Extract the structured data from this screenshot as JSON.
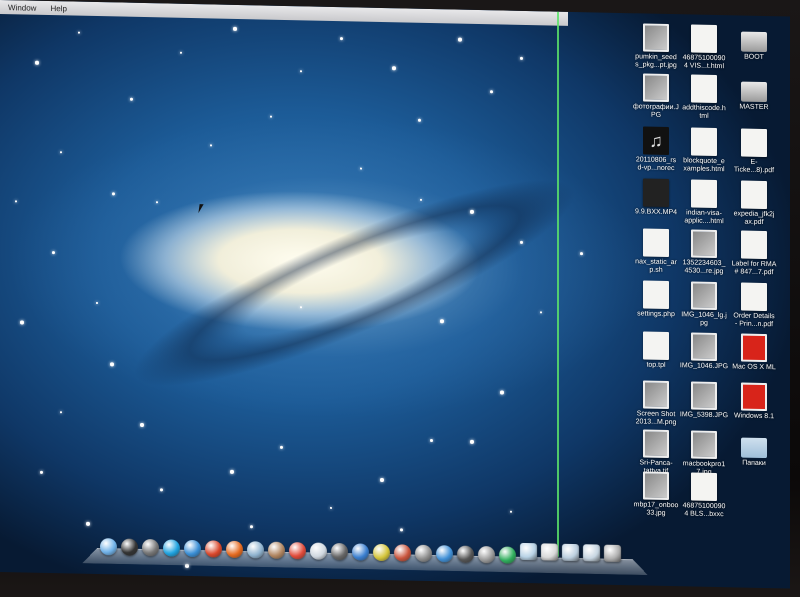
{
  "menu_bar": {
    "items": [
      "Window",
      "Help"
    ]
  },
  "desktop_files": [
    {
      "name": "pumkin_seed\ns_pkg...pt.jpg",
      "icon": "image-icon"
    },
    {
      "name": "46875100090\n4 VIS...t.html",
      "icon": "html-document-icon"
    },
    {
      "name": "BOOT",
      "icon": "drive-icon"
    },
    {
      "name": "фотографии.J\nPG",
      "icon": "image-icon"
    },
    {
      "name": "addthiscode.h\ntml",
      "icon": "html-document-icon"
    },
    {
      "name": "MASTER",
      "icon": "drive-icon"
    },
    {
      "name": "20110806_rs\nd-vp...norec",
      "icon": "music-icon"
    },
    {
      "name": "blockquote_e\nxamples.html",
      "icon": "html-document-icon"
    },
    {
      "name": "E-\nTicke...8).pdf",
      "icon": "pdf-document-icon"
    },
    {
      "name": "9.9.BXX.MP4",
      "icon": "video-icon"
    },
    {
      "name": "indian-visa-\napplic....html",
      "icon": "html-document-icon"
    },
    {
      "name": "expedia_jfk2j\nax.pdf",
      "icon": "pdf-document-icon"
    },
    {
      "name": "nax_static_ar\np.sh",
      "icon": "shell-document-icon"
    },
    {
      "name": "1352234603_\n4530...re.jpg",
      "icon": "image-icon"
    },
    {
      "name": "Label for RMA\n# 847...7.pdf",
      "icon": "pdf-document-icon"
    },
    {
      "name": "settings.php",
      "icon": "php-document-icon"
    },
    {
      "name": "IMG_1046_lg.j\npg",
      "icon": "image-icon"
    },
    {
      "name": "Order Details\n- Prin...n.pdf",
      "icon": "pdf-document-icon"
    },
    {
      "name": "top.tpl",
      "icon": "document-icon"
    },
    {
      "name": "IMG_1046.JPG",
      "icon": "image-icon"
    },
    {
      "name": "Mac OS X ML",
      "icon": "parallels-icon"
    },
    {
      "name": "Screen Shot\n2013...M.png",
      "icon": "image-icon"
    },
    {
      "name": "IMG_5398.JPG",
      "icon": "image-icon"
    },
    {
      "name": "Windows 8.1",
      "icon": "parallels-icon"
    },
    {
      "name": "Sri-Panca-\ntattva.tif",
      "icon": "image-icon"
    },
    {
      "name": "macbookpro1\n7.jpg",
      "icon": "image-icon"
    },
    {
      "name": "Папаки",
      "icon": "folder-icon"
    },
    {
      "name": "mbp17_onboo\n33.jpg",
      "icon": "image-icon"
    },
    {
      "name": "46875100090\n4 BLS...bxxc",
      "icon": "document-icon"
    }
  ],
  "dock": {
    "apps": [
      {
        "name": "finder-icon",
        "color": "#6fb1e8"
      },
      {
        "name": "dashboard-icon",
        "color": "#333333"
      },
      {
        "name": "launchpad-icon",
        "color": "#777777"
      },
      {
        "name": "skype-icon",
        "color": "#1fa3e0"
      },
      {
        "name": "safari-icon",
        "color": "#3a8fd6"
      },
      {
        "name": "chrome-icon",
        "color": "#d9472b"
      },
      {
        "name": "firefox-icon",
        "color": "#e56a1f"
      },
      {
        "name": "mail-icon",
        "color": "#8fb3cf"
      },
      {
        "name": "contacts-icon",
        "color": "#b08560"
      },
      {
        "name": "calendar-icon",
        "color": "#e04a3a"
      },
      {
        "name": "preview-icon",
        "color": "#cfd7df"
      },
      {
        "name": "photos-icon",
        "color": "#666666"
      },
      {
        "name": "itunes-icon",
        "color": "#3a7fd0"
      },
      {
        "name": "ical-icon",
        "color": "#d4c53a"
      },
      {
        "name": "sublime-icon",
        "color": "#c9543c"
      },
      {
        "name": "system-preferences-icon",
        "color": "#8f8f8f"
      },
      {
        "name": "app-store-icon",
        "color": "#3f8fd6"
      },
      {
        "name": "terminal-icon",
        "color": "#555555"
      },
      {
        "name": "activity-monitor-icon",
        "color": "#999999"
      },
      {
        "name": "crossover-icon",
        "color": "#2fae5c"
      },
      {
        "name": "downloads-icon",
        "color": "#b9d3e6"
      },
      {
        "name": "documents-icon",
        "color": "#d9d9d9"
      },
      {
        "name": "applications-icon",
        "color": "#bccfdf"
      },
      {
        "name": "stack-icon",
        "color": "#c7d6e2"
      },
      {
        "name": "trash-icon",
        "color": "#b0b0b0"
      }
    ]
  }
}
